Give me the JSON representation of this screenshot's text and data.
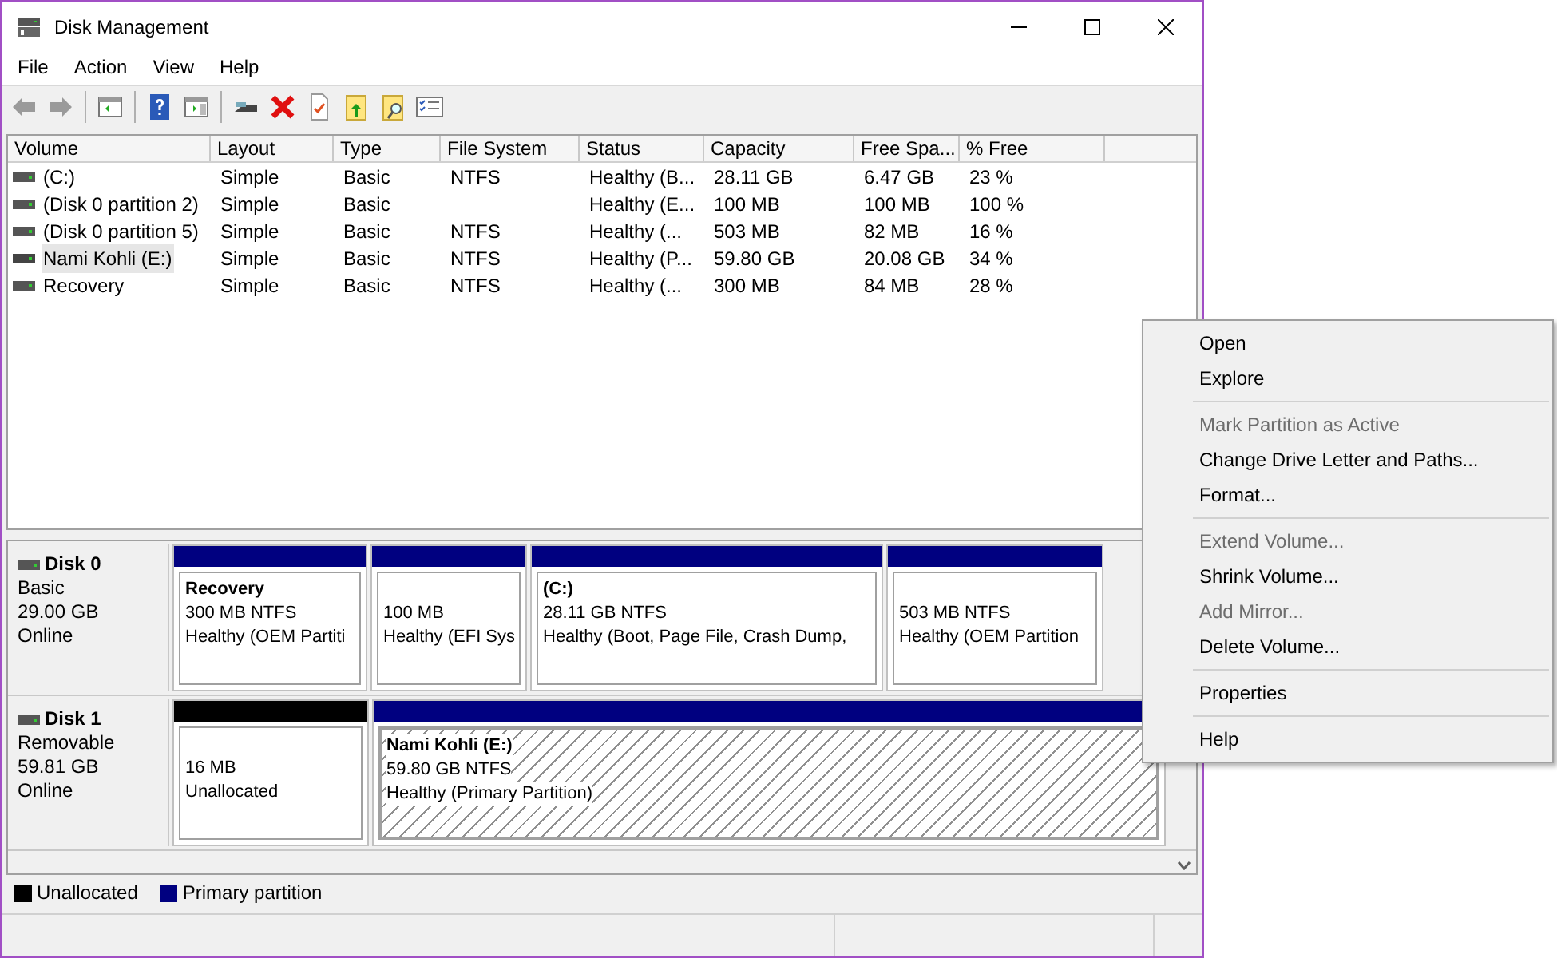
{
  "window": {
    "title": "Disk Management"
  },
  "menu_bar": [
    "File",
    "Action",
    "View",
    "Help"
  ],
  "volume_table": {
    "columns": [
      "Volume",
      "Layout",
      "Type",
      "File System",
      "Status",
      "Capacity",
      "Free Spa...",
      "% Free"
    ],
    "rows": [
      {
        "selected": false,
        "cells": [
          "(C:)",
          "Simple",
          "Basic",
          "NTFS",
          "Healthy (B...",
          "28.11 GB",
          "6.47 GB",
          "23 %"
        ]
      },
      {
        "selected": false,
        "cells": [
          "(Disk 0 partition 2)",
          "Simple",
          "Basic",
          "",
          "Healthy (E...",
          "100 MB",
          "100 MB",
          "100 %"
        ]
      },
      {
        "selected": false,
        "cells": [
          "(Disk 0 partition 5)",
          "Simple",
          "Basic",
          "NTFS",
          "Healthy (...",
          "503 MB",
          "82 MB",
          "16 %"
        ]
      },
      {
        "selected": true,
        "cells": [
          "Nami Kohli (E:)",
          "Simple",
          "Basic",
          "NTFS",
          "Healthy (P...",
          "59.80 GB",
          "20.08 GB",
          "34 %"
        ]
      },
      {
        "selected": false,
        "cells": [
          "Recovery",
          "Simple",
          "Basic",
          "NTFS",
          "Healthy (...",
          "300 MB",
          "84 MB",
          "28 %"
        ]
      }
    ]
  },
  "disks": [
    {
      "name": "Disk 0",
      "type": "Basic",
      "size": "29.00 GB",
      "status": "Online",
      "partitions": [
        {
          "kind": "primary",
          "selected": false,
          "name": "Recovery",
          "size": "300 MB NTFS",
          "status": "Healthy (OEM Partiti"
        },
        {
          "kind": "primary",
          "selected": false,
          "size": "100 MB",
          "status": "Healthy (EFI Sys"
        },
        {
          "kind": "primary",
          "selected": false,
          "name": "(C:)",
          "size": "28.11 GB NTFS",
          "status": "Healthy (Boot, Page File, Crash Dump,"
        },
        {
          "kind": "primary",
          "selected": false,
          "size": "503 MB NTFS",
          "status": "Healthy (OEM Partition"
        }
      ]
    },
    {
      "name": "Disk 1",
      "type": "Removable",
      "size": "59.81 GB",
      "status": "Online",
      "partitions": [
        {
          "kind": "unallocated",
          "selected": false,
          "size": "16 MB",
          "status": "Unallocated"
        },
        {
          "kind": "primary",
          "selected": true,
          "name": "Nami Kohli  (E:)",
          "size": "59.80 GB NTFS",
          "status": "Healthy (Primary Partition)"
        }
      ]
    }
  ],
  "legend": [
    {
      "kind": "unallocated",
      "label": "Unallocated"
    },
    {
      "kind": "primary",
      "label": "Primary partition"
    }
  ],
  "context_menu": [
    {
      "kind": "item",
      "label": "Open",
      "disabled": false
    },
    {
      "kind": "item",
      "label": "Explore",
      "disabled": false
    },
    {
      "kind": "separator"
    },
    {
      "kind": "item",
      "label": "Mark Partition as Active",
      "disabled": true
    },
    {
      "kind": "item",
      "label": "Change Drive Letter and Paths...",
      "disabled": false
    },
    {
      "kind": "item",
      "label": "Format...",
      "disabled": false
    },
    {
      "kind": "separator"
    },
    {
      "kind": "item",
      "label": "Extend Volume...",
      "disabled": true
    },
    {
      "kind": "item",
      "label": "Shrink Volume...",
      "disabled": false
    },
    {
      "kind": "item",
      "label": "Add Mirror...",
      "disabled": true
    },
    {
      "kind": "item",
      "label": "Delete Volume...",
      "disabled": false
    },
    {
      "kind": "separator"
    },
    {
      "kind": "item",
      "label": "Properties",
      "disabled": false
    },
    {
      "kind": "separator"
    },
    {
      "kind": "item",
      "label": "Help",
      "disabled": false
    }
  ]
}
